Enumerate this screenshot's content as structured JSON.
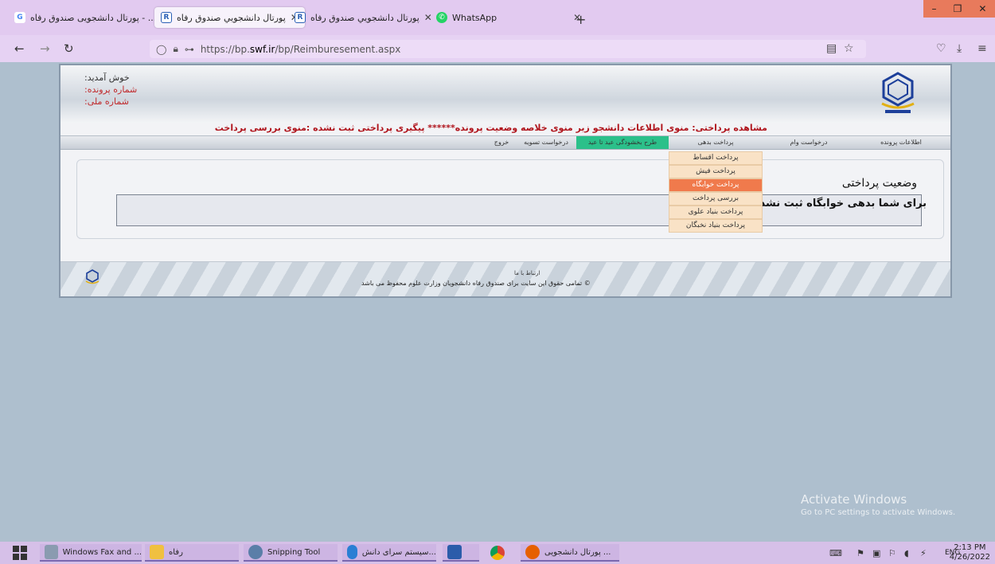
{
  "browser": {
    "tabs": [
      {
        "title": "پورتال دانشجویی صندوق رفاه - ...",
        "icon": "google-icon",
        "active": false
      },
      {
        "title": "پورتال دانشجويي صندوق رفاه",
        "icon": "rf-icon",
        "active": true
      },
      {
        "title": "پورتال دانشجويي صندوق رفاه",
        "icon": "rf-icon",
        "active": false
      },
      {
        "title": "WhatsApp",
        "icon": "whatsapp-icon",
        "active": false
      }
    ],
    "url_prefix": "https://bp.",
    "url_host": "swf.ir",
    "url_path": "/bp/Reimburesement.aspx"
  },
  "header": {
    "welcome": "خوش آمدید:",
    "file_no_label": "شماره پرونده:",
    "national_id_label": "شماره ملی:"
  },
  "notice": "مشاهده پرداختی: منوی اطلاعات دانشجو زیر منوی خلاصه وضعیت پرونده****** پیگیری پرداختی ثبت نشده :منوی بررسی پرداخت",
  "menu": {
    "file_info": "اطلاعات پرونده",
    "loan_request": "درخواست وام",
    "debt_payment": "پرداخت بدهی",
    "forgiveness_plan": "طرح بخشودگی عید تا عید",
    "settlement_request": "درخواست تسویه",
    "exit": "خروج"
  },
  "submenu": {
    "installments": "پرداخت اقساط",
    "receipt": "پرداخت فیش",
    "dormitory": "پرداخت خوابگاه",
    "review": "بررسی پرداخت",
    "alavi": "پرداخت بنیاد علوی",
    "elites": "پرداخت بنیاد نخبگان"
  },
  "main": {
    "title": "وضعیت پرداختی",
    "message": "برای شما بدهی خوابگاه ثبت نشده است"
  },
  "footer": {
    "contact": "ارتباط با ما",
    "copyright": "© تمامی حقوق این سایت برای صندوق رفاه دانشجویان وزارت علوم محفوظ می باشد"
  },
  "watermark": {
    "line1": "Activate Windows",
    "line2": "Go to PC settings to activate Windows."
  },
  "taskbar": {
    "items": [
      "Windows Fax and ...",
      "رفاه",
      "Snipping Tool",
      "سیستم سرای دانش...",
      "",
      "",
      "پورتال دانشجویی ..."
    ],
    "lang": "ENG",
    "time": "2:13 PM",
    "date": "4/26/2022"
  }
}
